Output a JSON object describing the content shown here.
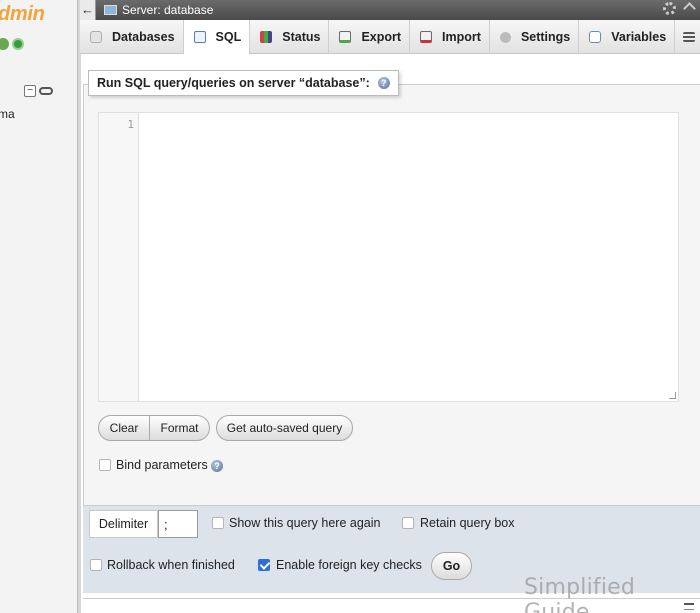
{
  "nav": {
    "logo_fragment": "dmin",
    "db_fragment": "ma",
    "collapse_symbol": "−"
  },
  "topbar": {
    "back_symbol": "←",
    "title": "Server: database"
  },
  "tabs": [
    {
      "label": "Databases",
      "icon": "database-icon"
    },
    {
      "label": "SQL",
      "icon": "sql-icon",
      "active": true
    },
    {
      "label": "Status",
      "icon": "status-icon"
    },
    {
      "label": "Export",
      "icon": "export-icon"
    },
    {
      "label": "Import",
      "icon": "import-icon"
    },
    {
      "label": "Settings",
      "icon": "wrench-icon"
    },
    {
      "label": "Variables",
      "icon": "variables-icon"
    }
  ],
  "query": {
    "legend": "Run SQL query/queries on server “database”:",
    "help_glyph": "?",
    "line_number": "1",
    "editor_value": ""
  },
  "buttons": {
    "clear": "Clear",
    "format": "Format",
    "auto_saved": "Get auto-saved query",
    "go": "Go"
  },
  "bind_parameters": {
    "label": "Bind parameters",
    "checked": false
  },
  "options": {
    "delimiter_label": "Delimiter",
    "delimiter_value": ";",
    "show_query": {
      "label": "Show this query here again",
      "checked": false
    },
    "retain_query": {
      "label": "Retain query box",
      "checked": false
    },
    "rollback": {
      "label": "Rollback when finished",
      "checked": false
    },
    "foreign_keys": {
      "label": "Enable foreign key checks",
      "checked": true
    }
  },
  "watermark": "Simplified Guide",
  "colors": {
    "logo_orange": "#f0a43a",
    "topbar": "#5a5a5a",
    "checkbox_on": "#2f6fd6",
    "options_bar": "#dde3ea"
  }
}
